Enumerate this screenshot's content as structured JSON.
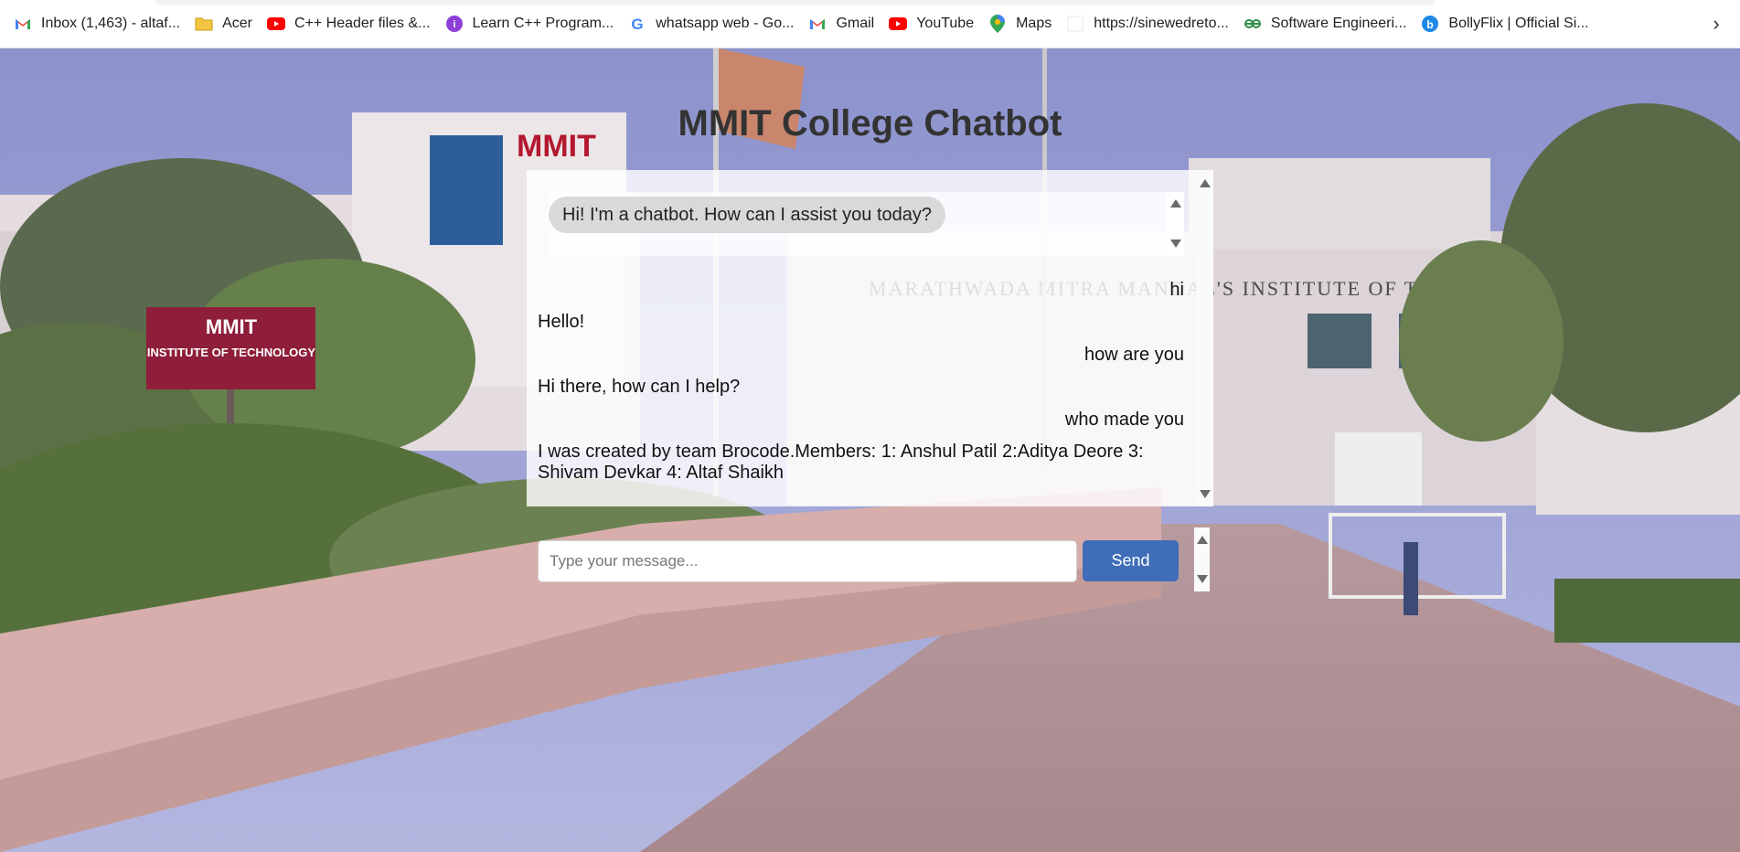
{
  "bookmarks": [
    {
      "label": "Inbox (1,463) - altaf...",
      "icon": "gmail-icon"
    },
    {
      "label": "Acer",
      "icon": "folder-icon"
    },
    {
      "label": "C++ Header files &...",
      "icon": "youtube-icon"
    },
    {
      "label": "Learn C++ Program...",
      "icon": "site-icon"
    },
    {
      "label": "whatsapp web - Go...",
      "icon": "google-icon"
    },
    {
      "label": "Gmail",
      "icon": "gmail-icon"
    },
    {
      "label": "YouTube",
      "icon": "youtube-icon"
    },
    {
      "label": "Maps",
      "icon": "maps-icon"
    },
    {
      "label": "https://sinewedreto...",
      "icon": "blank-page-icon"
    },
    {
      "label": "Software Engineeri...",
      "icon": "geeks-icon"
    },
    {
      "label": "BollyFlix | Official Si...",
      "icon": "bollyflix-icon"
    }
  ],
  "page": {
    "title": "MMIT College Chatbot"
  },
  "scene_text": {
    "building_sign": "MMIT",
    "banner": "MARATHWADA MITRA MANDAL'S INSTITUTE OF TECHNOLOGY",
    "board_title": "MMIT",
    "board_subtitle": "INSTITUTE OF TECHNOLOGY"
  },
  "chat": {
    "greeting": "Hi! I'm a chatbot. How can I assist you today?",
    "messages": [
      {
        "from": "user",
        "text": "hi"
      },
      {
        "from": "bot",
        "text": "Hello!"
      },
      {
        "from": "user",
        "text": "how are you"
      },
      {
        "from": "bot",
        "text": "Hi there, how can I help?"
      },
      {
        "from": "user",
        "text": "who made you"
      },
      {
        "from": "bot",
        "text": "I was created by team Brocode.Members: 1: Anshul Patil 2:Aditya Deore 3: Shivam Devkar 4: Altaf Shaikh"
      }
    ]
  },
  "input": {
    "placeholder": "Type your message...",
    "value": "",
    "send_label": "Send"
  },
  "colors": {
    "send_button": "#3f6db8",
    "bubble": "#d9d9d9",
    "title": "#333333"
  }
}
